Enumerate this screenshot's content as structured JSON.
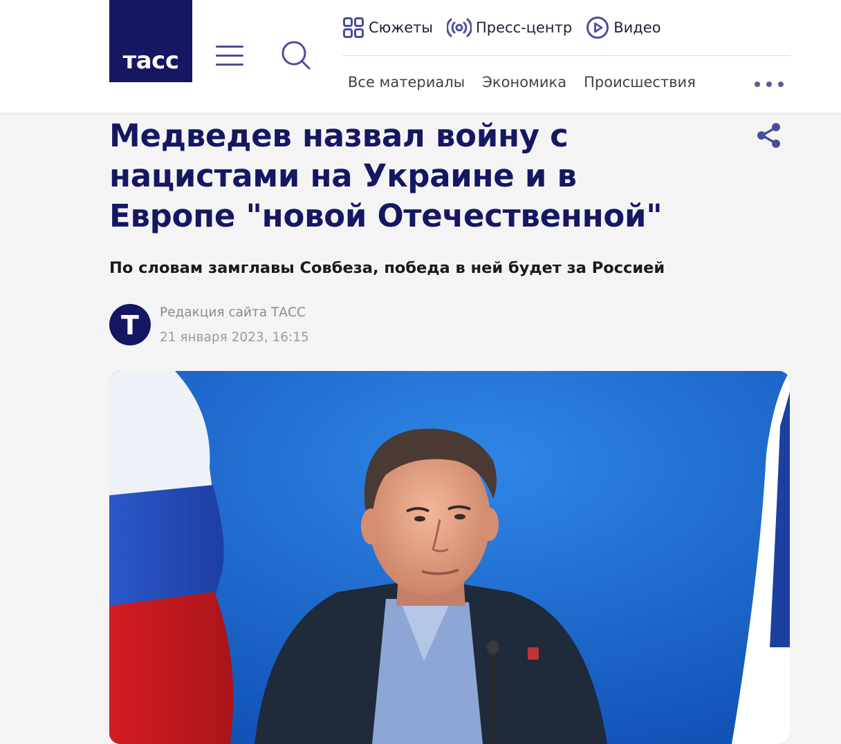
{
  "header": {
    "logo_text": "тасс",
    "top_nav": [
      {
        "label": "Сюжеты",
        "icon": "grid-icon"
      },
      {
        "label": "Пресс-центр",
        "icon": "broadcast-icon"
      },
      {
        "label": "Видео",
        "icon": "play-circle-icon"
      }
    ],
    "sections": [
      "Все материалы",
      "Экономика",
      "Происшествия"
    ]
  },
  "article": {
    "title": "Медведев назвал войну с нацистами на Украине и в Европе \"новой Отечественной\"",
    "lead": "По словам замглавы Совбеза, победа в ней будет за Россией",
    "author_initial": "Т",
    "author": "Редакция сайта ТАСС",
    "date": "21 января 2023, 16:15"
  },
  "colors": {
    "brand_navy": "#151763",
    "accent_icon": "#4a4d9a",
    "page_bg": "#f4f4f5"
  }
}
